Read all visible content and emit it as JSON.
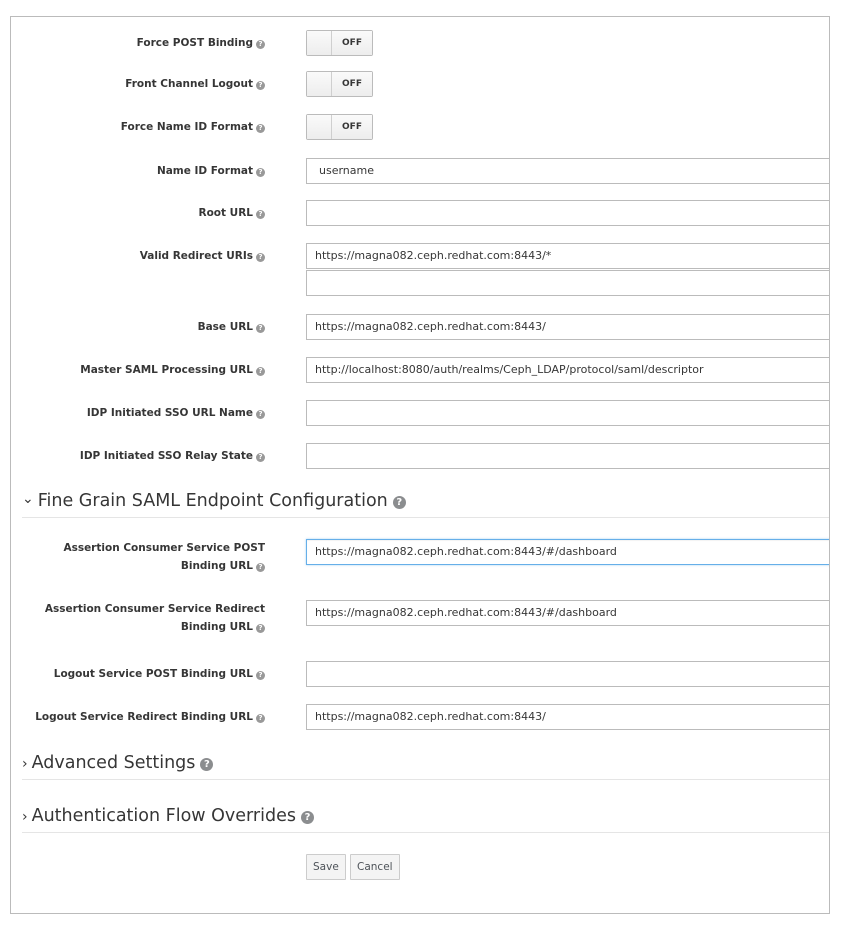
{
  "fields": {
    "force_post_binding": {
      "label": "Force POST Binding",
      "state": "OFF"
    },
    "front_channel_logout": {
      "label": "Front Channel Logout",
      "state": "OFF"
    },
    "force_name_id_format": {
      "label": "Force Name ID Format",
      "state": "OFF"
    },
    "name_id_format": {
      "label": "Name ID Format",
      "value": "username"
    },
    "root_url": {
      "label": "Root URL",
      "value": ""
    },
    "valid_redirect_uris": {
      "label": "Valid Redirect URIs",
      "values": [
        "https://magna082.ceph.redhat.com:8443/*",
        ""
      ]
    },
    "base_url": {
      "label": "Base URL",
      "value": "https://magna082.ceph.redhat.com:8443/"
    },
    "master_saml_url": {
      "label": "Master SAML Processing URL",
      "value": "http://localhost:8080/auth/realms/Ceph_LDAP/protocol/saml/descriptor"
    },
    "idp_sso_url_name": {
      "label": "IDP Initiated SSO URL Name",
      "value": ""
    },
    "idp_sso_relay_state": {
      "label": "IDP Initiated SSO Relay State",
      "value": ""
    }
  },
  "fine_grain": {
    "title": "Fine Grain SAML Endpoint Configuration",
    "chevron": "expanded",
    "acs_post": {
      "label_line1": "Assertion Consumer Service POST",
      "label_line2": "Binding URL",
      "value": "https://magna082.ceph.redhat.com:8443/#/dashboard"
    },
    "acs_redirect": {
      "label_line1": "Assertion Consumer Service Redirect",
      "label_line2": "Binding URL",
      "value": "https://magna082.ceph.redhat.com:8443/#/dashboard"
    },
    "logout_post": {
      "label": "Logout Service POST Binding URL",
      "value": ""
    },
    "logout_redirect": {
      "label": "Logout Service Redirect Binding URL",
      "value": "https://magna082.ceph.redhat.com:8443/"
    }
  },
  "sections": {
    "advanced": {
      "title": "Advanced Settings",
      "chevron": "collapsed"
    },
    "auth_flow": {
      "title": "Authentication Flow Overrides",
      "chevron": "collapsed"
    }
  },
  "icons": {
    "help": "?",
    "chevron_down": "⌄",
    "chevron_right": "›"
  },
  "actions": {
    "save": "Save",
    "cancel": "Cancel"
  },
  "colors": {
    "focus_border": "#66afe9",
    "border": "#bbbbbb",
    "help_icon": "#999999"
  }
}
